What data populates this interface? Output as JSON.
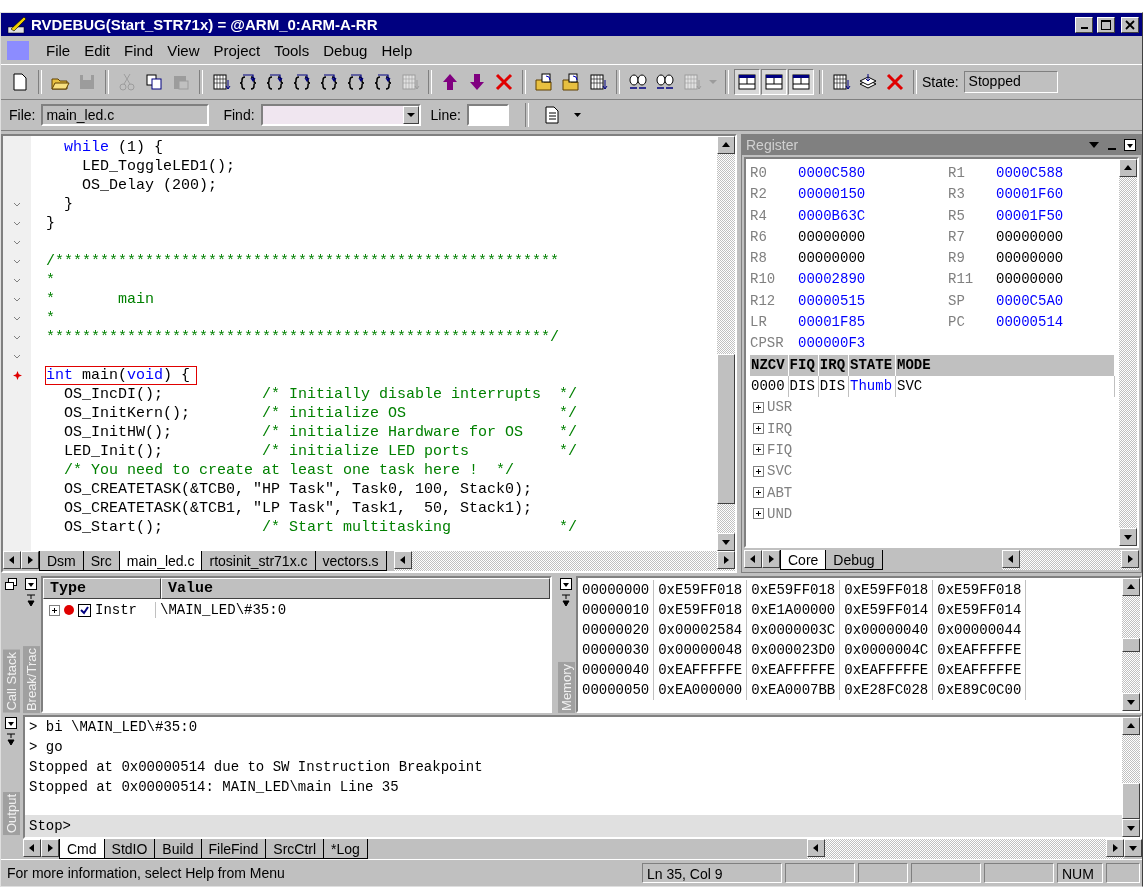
{
  "window": {
    "title": "RVDEBUG(Start_STR71x) = @ARM_0:ARM-A-RR"
  },
  "menu": [
    {
      "label": "File"
    },
    {
      "label": "Edit"
    },
    {
      "label": "Find"
    },
    {
      "label": "View"
    },
    {
      "label": "Project"
    },
    {
      "label": "Tools"
    },
    {
      "label": "Debug"
    },
    {
      "label": "Help"
    }
  ],
  "toolbar": [
    {
      "kind": "new",
      "disabled": false,
      "pressed": false
    },
    {
      "kind": "sep"
    },
    {
      "kind": "open",
      "disabled": false,
      "pressed": false
    },
    {
      "kind": "save",
      "disabled": true,
      "pressed": false
    },
    {
      "kind": "sep"
    },
    {
      "kind": "cut",
      "disabled": true,
      "pressed": false
    },
    {
      "kind": "copy",
      "disabled": false,
      "pressed": false
    },
    {
      "kind": "paste",
      "disabled": true,
      "pressed": false
    },
    {
      "kind": "sep"
    },
    {
      "kind": "grid",
      "disabled": false,
      "pressed": false
    },
    {
      "kind": "braces",
      "disabled": false,
      "pressed": false
    },
    {
      "kind": "braces",
      "disabled": false,
      "pressed": false
    },
    {
      "kind": "braces",
      "disabled": false,
      "pressed": false
    },
    {
      "kind": "braces",
      "disabled": false,
      "pressed": false
    },
    {
      "kind": "braces",
      "disabled": false,
      "pressed": false
    },
    {
      "kind": "braces",
      "disabled": false,
      "pressed": false
    },
    {
      "kind": "grid",
      "disabled": true,
      "pressed": false
    },
    {
      "kind": "sep"
    },
    {
      "kind": "up",
      "disabled": false,
      "pressed": false
    },
    {
      "kind": "down",
      "disabled": false,
      "pressed": false
    },
    {
      "kind": "cross",
      "disabled": false,
      "pressed": false
    },
    {
      "kind": "sep"
    },
    {
      "kind": "folder",
      "disabled": false,
      "pressed": false
    },
    {
      "kind": "folder",
      "disabled": false,
      "pressed": false
    },
    {
      "kind": "grid",
      "disabled": false,
      "pressed": false
    },
    {
      "kind": "sep"
    },
    {
      "kind": "plug",
      "disabled": false,
      "pressed": false
    },
    {
      "kind": "plug",
      "disabled": false,
      "pressed": false
    },
    {
      "kind": "grid",
      "disabled": true,
      "pressed": false
    },
    {
      "kind": "caret",
      "disabled": true,
      "pressed": false
    },
    {
      "kind": "sep"
    },
    {
      "kind": "layout",
      "disabled": false,
      "pressed": true
    },
    {
      "kind": "layout",
      "disabled": false,
      "pressed": true
    },
    {
      "kind": "layout",
      "disabled": false,
      "pressed": true
    },
    {
      "kind": "sep"
    },
    {
      "kind": "grid",
      "disabled": false,
      "pressed": false
    },
    {
      "kind": "stack",
      "disabled": false,
      "pressed": false
    },
    {
      "kind": "cross",
      "disabled": false,
      "pressed": false
    },
    {
      "kind": "sep"
    }
  ],
  "state": {
    "label": "State:",
    "value": "Stopped"
  },
  "findbar": {
    "file_label": "File:",
    "file": "main_led.c",
    "find_label": "Find:",
    "line_label": "Line:"
  },
  "editor": {
    "lines": [
      {
        "fold": false,
        "breakpoint": false,
        "current": false,
        "segments": [
          {
            "text": "  while",
            "kind": "keyword"
          },
          {
            "text": " (1) {",
            "kind": "code"
          }
        ]
      },
      {
        "fold": false,
        "breakpoint": false,
        "current": false,
        "segments": [
          {
            "text": "    LED_ToggleLED1();",
            "kind": "code"
          }
        ]
      },
      {
        "fold": false,
        "breakpoint": false,
        "current": false,
        "segments": [
          {
            "text": "    OS_Delay (200);",
            "kind": "code"
          }
        ]
      },
      {
        "fold": true,
        "breakpoint": false,
        "current": false,
        "segments": [
          {
            "text": "  }",
            "kind": "code"
          }
        ]
      },
      {
        "fold": true,
        "breakpoint": false,
        "current": false,
        "segments": [
          {
            "text": "}",
            "kind": "code"
          }
        ]
      },
      {
        "fold": true,
        "breakpoint": false,
        "current": false
      },
      {
        "fold": true,
        "breakpoint": false,
        "current": false,
        "segments": [
          {
            "text": "/********************************************************",
            "kind": "comment"
          }
        ]
      },
      {
        "fold": true,
        "breakpoint": false,
        "current": false,
        "segments": [
          {
            "text": "*",
            "kind": "comment"
          }
        ]
      },
      {
        "fold": true,
        "breakpoint": false,
        "current": false,
        "segments": [
          {
            "text": "*       main",
            "kind": "comment"
          }
        ]
      },
      {
        "fold": true,
        "breakpoint": false,
        "current": false,
        "segments": [
          {
            "text": "*",
            "kind": "comment"
          }
        ]
      },
      {
        "fold": true,
        "breakpoint": false,
        "current": false,
        "segments": [
          {
            "text": "********************************************************/",
            "kind": "comment"
          }
        ]
      },
      {
        "fold": true,
        "breakpoint": false,
        "current": false
      },
      {
        "fold": false,
        "breakpoint": true,
        "current": true,
        "segments": [
          {
            "text": "int",
            "kind": "keyword"
          },
          {
            "text": " main(",
            "kind": "code"
          },
          {
            "text": "void",
            "kind": "keyword"
          },
          {
            "text": ") {",
            "kind": "code"
          }
        ]
      },
      {
        "fold": false,
        "breakpoint": false,
        "current": false,
        "segments": [
          {
            "text": "  OS_IncDI();           ",
            "kind": "code"
          },
          {
            "text": "/* Initially disable interrupts  */",
            "kind": "comment"
          }
        ]
      },
      {
        "fold": false,
        "breakpoint": false,
        "current": false,
        "segments": [
          {
            "text": "  OS_InitKern();        ",
            "kind": "code"
          },
          {
            "text": "/* initialize OS                 */",
            "kind": "comment"
          }
        ]
      },
      {
        "fold": false,
        "breakpoint": false,
        "current": false,
        "segments": [
          {
            "text": "  OS_InitHW();          ",
            "kind": "code"
          },
          {
            "text": "/* initialize Hardware for OS    */",
            "kind": "comment"
          }
        ]
      },
      {
        "fold": false,
        "breakpoint": false,
        "current": false,
        "segments": [
          {
            "text": "  LED_Init();           ",
            "kind": "code"
          },
          {
            "text": "/* initialize LED ports          */",
            "kind": "comment"
          }
        ]
      },
      {
        "fold": false,
        "breakpoint": false,
        "current": false,
        "segments": [
          {
            "text": "  /* You need to create at least one task here !  */",
            "kind": "comment"
          }
        ]
      },
      {
        "fold": false,
        "breakpoint": false,
        "current": false,
        "segments": [
          {
            "text": "  OS_CREATETASK(&TCB0, \"HP Task\", Task0, 100, Stack0);",
            "kind": "code"
          }
        ]
      },
      {
        "fold": false,
        "breakpoint": false,
        "current": false,
        "segments": [
          {
            "text": "  OS_CREATETASK(&TCB1, \"LP Task\", Task1,  50, Stack1);",
            "kind": "code"
          }
        ]
      },
      {
        "fold": false,
        "breakpoint": false,
        "current": false,
        "segments": [
          {
            "text": "  OS_Start();           ",
            "kind": "code"
          },
          {
            "text": "/* Start multitasking            */",
            "kind": "comment"
          }
        ]
      }
    ],
    "tabs": [
      {
        "label": "Dsm",
        "selected": false
      },
      {
        "label": "Src",
        "selected": false
      },
      {
        "label": "main_led.c",
        "selected": true
      },
      {
        "label": "rtosinit_str71x.c",
        "selected": false
      },
      {
        "label": "vectors.s",
        "selected": false
      }
    ]
  },
  "register": {
    "title": "Register",
    "registers": [
      {
        "name": "R0",
        "value": "0000C580",
        "changed": true
      },
      {
        "name": "R1",
        "value": "0000C588",
        "changed": true
      },
      {
        "name": "R2",
        "value": "00000150",
        "changed": true
      },
      {
        "name": "R3",
        "value": "00001F60",
        "changed": true
      },
      {
        "name": "R4",
        "value": "0000B63C",
        "changed": true
      },
      {
        "name": "R5",
        "value": "00001F50",
        "changed": true
      },
      {
        "name": "R6",
        "value": "00000000",
        "changed": false
      },
      {
        "name": "R7",
        "value": "00000000",
        "changed": false
      },
      {
        "name": "R8",
        "value": "00000000",
        "changed": false
      },
      {
        "name": "R9",
        "value": "00000000",
        "changed": false
      },
      {
        "name": "R10",
        "value": "00002890",
        "changed": true
      },
      {
        "name": "R11",
        "value": "00000000",
        "changed": false
      },
      {
        "name": "R12",
        "value": "00000515",
        "changed": true
      },
      {
        "name": "SP",
        "value": "0000C5A0",
        "changed": true
      },
      {
        "name": "LR",
        "value": "00001F85",
        "changed": true
      },
      {
        "name": "PC",
        "value": "00000514",
        "changed": true
      },
      {
        "name": "CPSR",
        "value": "000000F3",
        "changed": true
      }
    ],
    "flags": [
      {
        "label": "NZCV",
        "value": "0000",
        "changed": false
      },
      {
        "label": "FIQ",
        "value": "DIS",
        "changed": false
      },
      {
        "label": "IRQ",
        "value": "DIS",
        "changed": false
      },
      {
        "label": "STATE",
        "value": "Thumb",
        "changed": true
      },
      {
        "label": "MODE",
        "value": "SVC",
        "changed": false
      }
    ],
    "modes": [
      {
        "label": "USR",
        "expanded": false
      },
      {
        "label": "IRQ",
        "expanded": false
      },
      {
        "label": "FIQ",
        "expanded": false
      },
      {
        "label": "SVC",
        "expanded": false
      },
      {
        "label": "ABT",
        "expanded": false
      },
      {
        "label": "UND",
        "expanded": false
      }
    ],
    "tabs": [
      {
        "label": "Core",
        "selected": true
      },
      {
        "label": "Debug",
        "selected": false
      }
    ]
  },
  "breakpoints": {
    "side_labels": [
      "Call Stack",
      "Break/Trac"
    ],
    "columns": [
      "Type",
      "Value"
    ],
    "rows": [
      {
        "expanded": false,
        "enabled": true,
        "checked": true,
        "type": "Instr",
        "value": "\\MAIN_LED\\#35:0"
      }
    ]
  },
  "memory": {
    "side_label": "Memory",
    "rows": [
      {
        "address": "00000000",
        "values": [
          "0xE59FF018",
          "0xE59FF018",
          "0xE59FF018",
          "0xE59FF018"
        ]
      },
      {
        "address": "00000010",
        "values": [
          "0xE59FF018",
          "0xE1A00000",
          "0xE59FF014",
          "0xE59FF014"
        ]
      },
      {
        "address": "00000020",
        "values": [
          "0x00002584",
          "0x0000003C",
          "0x00000040",
          "0x00000044"
        ]
      },
      {
        "address": "00000030",
        "values": [
          "0x00000048",
          "0x000023D0",
          "0x0000004C",
          "0xEAFFFFFE"
        ]
      },
      {
        "address": "00000040",
        "values": [
          "0xEAFFFFFE",
          "0xEAFFFFFE",
          "0xEAFFFFFE",
          "0xEAFFFFFE"
        ]
      },
      {
        "address": "00000050",
        "values": [
          "0xEA000000",
          "0xEA0007BB",
          "0xE28FC028",
          "0xE89C0C00"
        ]
      }
    ]
  },
  "output": {
    "side_label": "Output",
    "lines": [
      "> bi \\MAIN_LED\\#35:0",
      "> go",
      "Stopped at 0x00000514 due to SW Instruction Breakpoint",
      "Stopped at 0x00000514: MAIN_LED\\main Line 35"
    ],
    "prompt": "Stop>",
    "tabs": [
      {
        "label": "Cmd",
        "selected": true
      },
      {
        "label": "StdIO",
        "selected": false
      },
      {
        "label": "Build",
        "selected": false
      },
      {
        "label": "FileFind",
        "selected": false
      },
      {
        "label": "SrcCtrl",
        "selected": false
      },
      {
        "label": "*Log",
        "selected": false
      }
    ]
  },
  "status_bar": {
    "message": "For more information, select Help from Menu",
    "position": "Ln 35, Col 9",
    "num": "NUM"
  }
}
